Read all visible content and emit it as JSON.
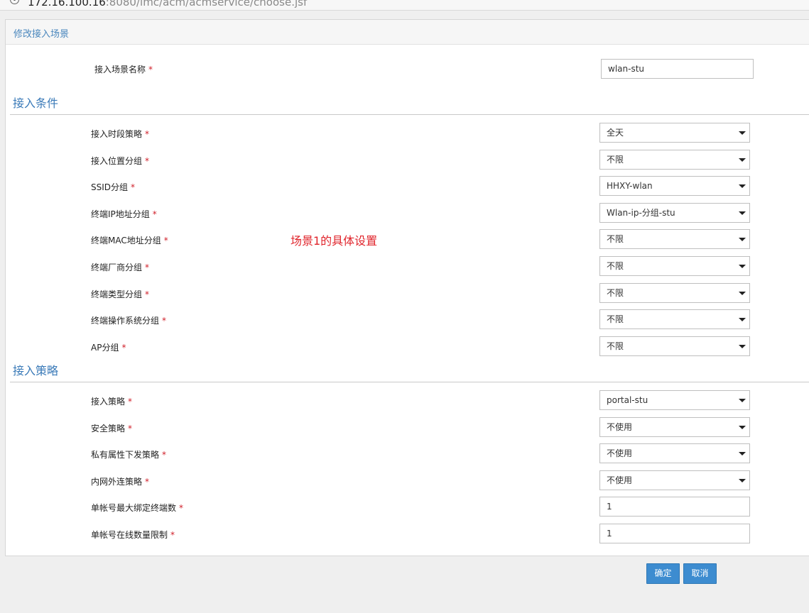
{
  "browser": {
    "url_host": "172.16.100.16",
    "url_rest": ":8080/imc/acm/acmservice/choose.jsf"
  },
  "panel_title": "修改接入场景",
  "scene_name": {
    "label": "接入场景名称",
    "value": "wlan-stu"
  },
  "required_mark": "*",
  "sections": {
    "conditions": "接入条件",
    "policies": "接入策略"
  },
  "conditions": [
    {
      "label": "接入时段策略",
      "value": "全天"
    },
    {
      "label": "接入位置分组",
      "value": "不限"
    },
    {
      "label": "SSID分组",
      "value": "HHXY-wlan"
    },
    {
      "label": "终端IP地址分组",
      "value": "Wlan-ip-分组-stu"
    },
    {
      "label": "终端MAC地址分组",
      "value": "不限"
    },
    {
      "label": "终端厂商分组",
      "value": "不限"
    },
    {
      "label": "终端类型分组",
      "value": "不限"
    },
    {
      "label": "终端操作系统分组",
      "value": "不限"
    },
    {
      "label": "AP分组",
      "value": "不限"
    }
  ],
  "policies": [
    {
      "label": "接入策略",
      "value": "portal-stu"
    },
    {
      "label": "安全策略",
      "value": "不使用"
    },
    {
      "label": "私有属性下发策略",
      "value": "不使用"
    },
    {
      "label": "内网外连策略",
      "value": "不使用"
    },
    {
      "label": "单帐号最大绑定终端数",
      "value": "1"
    },
    {
      "label": "单帐号在线数量限制",
      "value": "1"
    }
  ],
  "annotation": "场景1的具体设置",
  "buttons": {
    "ok": "确定",
    "cancel": "取消"
  },
  "colors": {
    "accent": "#3d8cd0",
    "section_title": "#3a7ab8",
    "required": "#d0202a",
    "annotation": "#e0242b"
  }
}
